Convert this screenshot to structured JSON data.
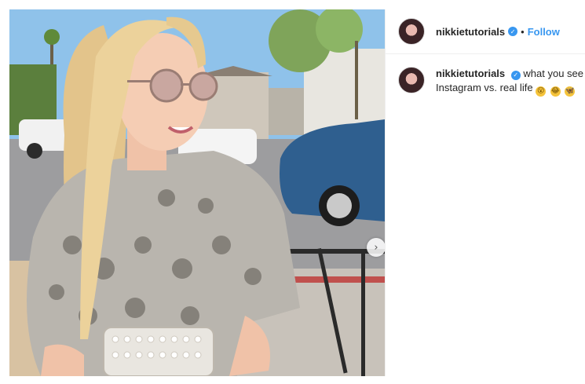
{
  "post": {
    "username": "nikkietutorials",
    "separator": "•",
    "follow_label": "Follow",
    "verified_glyph": "✓",
    "caption_text": "what you see",
    "caption_line2": "Instagram vs. real life",
    "caption_emojis": [
      "😮",
      "😂",
      "🦋"
    ],
    "carousel_next_glyph": "›"
  },
  "colors": {
    "link_blue": "#3897f0",
    "text": "#262626",
    "divider": "#efefef"
  }
}
